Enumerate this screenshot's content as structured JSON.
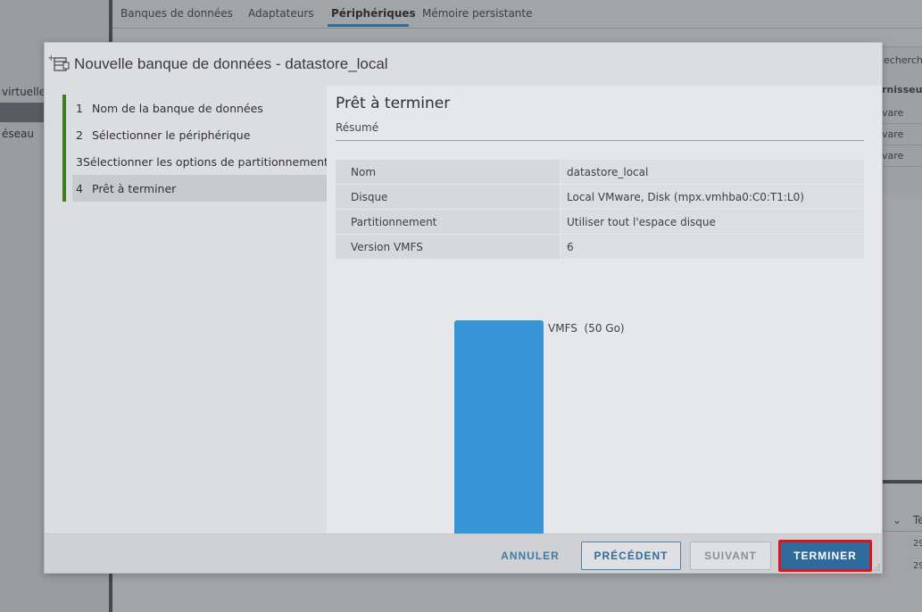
{
  "background": {
    "tabs": [
      "Banques de données",
      "Adaptateurs",
      "Périphériques",
      "Mémoire persistante"
    ],
    "active_tab": "Périphériques",
    "side_labels": [
      "virtuelle",
      "éseau"
    ],
    "right_fragments": {
      "search": "echerch",
      "header": "rnisseu",
      "rows": [
        "vare",
        "vare",
        "vare"
      ],
      "bottom_header": "Te",
      "bottom_rows": [
        "29",
        "29"
      ]
    }
  },
  "dialog": {
    "title": "Nouvelle banque de données - datastore_local",
    "steps": [
      {
        "num": "1",
        "label": "Nom de la banque de données"
      },
      {
        "num": "2",
        "label": "Sélectionner le périphérique"
      },
      {
        "num": "3",
        "label": "Sélectionner les options de partitionnement"
      },
      {
        "num": "4",
        "label": "Prêt à terminer"
      }
    ],
    "content": {
      "title": "Prêt à terminer",
      "subtitle": "Résumé",
      "summary": [
        {
          "label": "Nom",
          "value": "datastore_local"
        },
        {
          "label": "Disque",
          "value": "Local VMware, Disk (mpx.vmhba0:C0:T1:L0)"
        },
        {
          "label": "Partitionnement",
          "value": "Utiliser tout l'espace disque"
        },
        {
          "label": "Version VMFS",
          "value": "6"
        }
      ],
      "partition_label": "VMFS  (50 Go)",
      "partition_color": "#3595d6"
    },
    "buttons": {
      "cancel": "ANNULER",
      "previous": "PRÉCÉDENT",
      "next": "SUIVANT",
      "finish": "TERMINER"
    }
  }
}
